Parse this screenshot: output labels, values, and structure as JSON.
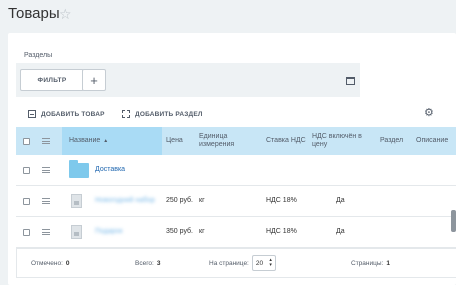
{
  "header": {
    "title": "Товары"
  },
  "sections": {
    "label": "Разделы",
    "filter_label": "ФИЛЬТР",
    "add_label": "+"
  },
  "toolbar": {
    "add_product": "ДОБАВИТЬ ТОВАР",
    "add_section": "ДОБАВИТЬ РАЗДЕЛ"
  },
  "grid": {
    "columns": {
      "name": "Название",
      "sort_arrow": "▲",
      "price": "Цена",
      "unit": "Единица измерения",
      "vat_rate": "Ставка НДС",
      "vat_included": "НДС включён в цену",
      "section": "Раздел",
      "description": "Описание"
    },
    "rows": [
      {
        "type": "section",
        "name": "Доставка"
      },
      {
        "type": "product",
        "name": "Новогодний набор",
        "price": "250 руб.",
        "unit": "кг",
        "vat_rate": "НДС 18%",
        "vat_included": "Да"
      },
      {
        "type": "product",
        "name": "Подарок",
        "price": "350 руб.",
        "unit": "кг",
        "vat_rate": "НДС 18%",
        "vat_included": "Да"
      }
    ]
  },
  "footer": {
    "selected_label": "Отмечено:",
    "selected_value": "0",
    "total_label": "Всего:",
    "total_value": "3",
    "per_page_label": "На странице:",
    "per_page_value": "20",
    "pages_label": "Страницы:",
    "pages_value": "1"
  },
  "colors": {
    "header_bg": "#c8e6f6",
    "sorted_col_bg": "#a9dbf5",
    "folder": "#7ec9ec",
    "link": "#2067b0"
  }
}
